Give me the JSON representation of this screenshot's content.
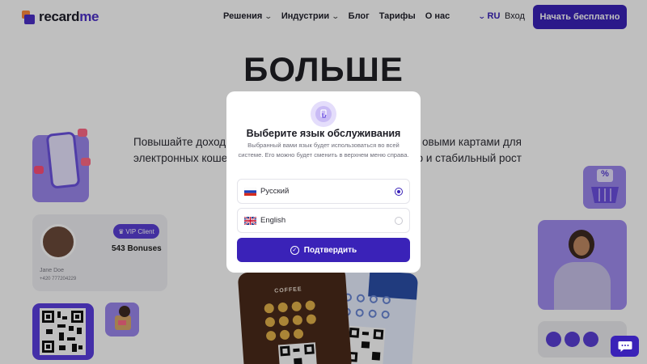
{
  "header": {
    "logo_text_main": "recard",
    "logo_text_accent": "me",
    "nav": [
      {
        "label": "Решения",
        "has_dropdown": true
      },
      {
        "label": "Индустрии",
        "has_dropdown": true
      },
      {
        "label": "Блог",
        "has_dropdown": false
      },
      {
        "label": "Тарифы",
        "has_dropdown": false
      },
      {
        "label": "О нас",
        "has_dropdown": false
      }
    ],
    "language": "RU",
    "login": "Вход",
    "cta": "Начать бесплатно"
  },
  "hero": {
    "title": "БОЛЬШЕ",
    "subtitle_line1": "Повышайте доходы",
    "subtitle_line1_end": "овыми картами для",
    "subtitle_line2": "электронных кошел",
    "subtitle_line2_end": "о и стабильный рост"
  },
  "cards": {
    "vip_badge": "VIP Client",
    "bonuses": "543 Bonuses",
    "holder_name": "Jane Doe",
    "holder_phone": "+420 777204229",
    "discount_symbol": "%",
    "coffee_label": "COFFEE"
  },
  "modal": {
    "title": "Выберите язык обслуживания",
    "description": "Выбранный вами язык будет использоваться во всей системе. Его можно будет сменить в верхнем меню справа.",
    "options": [
      {
        "label": "Русский",
        "flag": "ru-flag",
        "selected": true
      },
      {
        "label": "English",
        "flag": "uk-flag",
        "selected": false
      }
    ],
    "confirm": "Подтвердить"
  },
  "colors": {
    "brand": "#3a22b8",
    "accent": "#ff8a3d",
    "card_lavender": "#9b87ee",
    "overlay": "rgba(0,0,0,0.25)"
  },
  "icons": {
    "modal_icon": "hand-tap-icon",
    "confirm_icon": "check-circle-icon",
    "chat_icon": "chat-bubble-icon"
  }
}
